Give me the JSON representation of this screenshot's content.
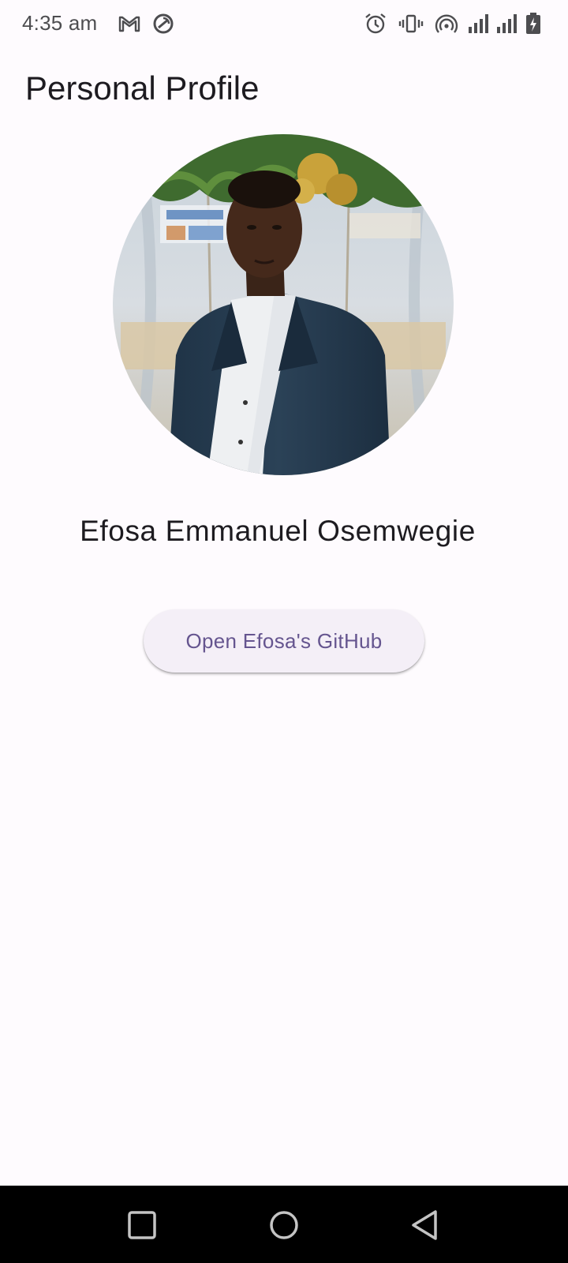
{
  "status_bar": {
    "time": "4:35 am",
    "left_icons": [
      "gmail-icon",
      "sync-icon"
    ],
    "right_icons": [
      "alarm-icon",
      "vibrate-icon",
      "hotspot-icon",
      "signal-icon",
      "signal-icon",
      "battery-charging-icon"
    ]
  },
  "app_bar": {
    "title": "Personal Profile"
  },
  "profile": {
    "photo_description": "profile-photo",
    "name": "Efosa Emmanuel Osemwegie",
    "button_label": "Open Efosa's GitHub"
  },
  "navigation_bar": {
    "buttons": [
      "recents-button",
      "home-button",
      "back-button"
    ]
  },
  "colors": {
    "background": "#fefbfe",
    "title_text": "#1d1b20",
    "button_bg": "#f4eff7",
    "button_text": "#65558f",
    "nav_bar": "#000000"
  }
}
